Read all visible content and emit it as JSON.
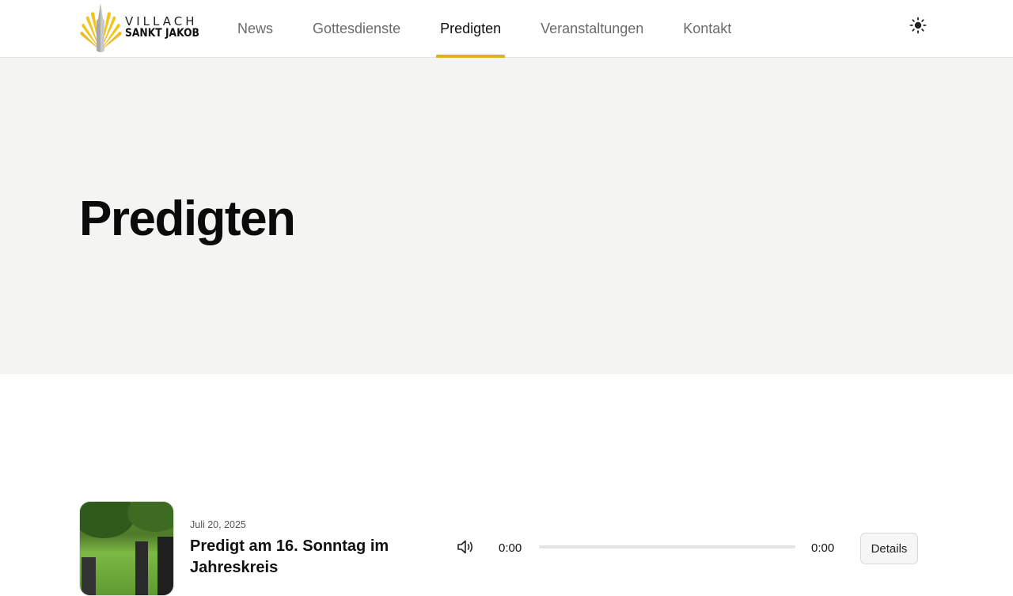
{
  "header": {
    "logo": {
      "line1": "VILLACH",
      "line2": "SANKT JAKOB"
    },
    "nav": [
      {
        "label": "News",
        "active": false
      },
      {
        "label": "Gottesdienste",
        "active": false
      },
      {
        "label": "Predigten",
        "active": true
      },
      {
        "label": "Veranstaltungen",
        "active": false
      },
      {
        "label": "Kontakt",
        "active": false
      }
    ],
    "theme_toggle_icon": "sun-icon"
  },
  "hero": {
    "title": "Predigten"
  },
  "sermons": [
    {
      "date": "Juli 20, 2025",
      "title": "Predigt am 16. Sonntag im Jahreskreis",
      "thumbnail_icon": "garden-photo",
      "player": {
        "current_time": "0:00",
        "duration": "0:00",
        "progress": 0,
        "volume_icon": "speaker-icon"
      },
      "details_label": "Details"
    }
  ],
  "colors": {
    "accent": "#e0b21a",
    "hero_bg": "#f4f4f2",
    "text": "#111111"
  }
}
